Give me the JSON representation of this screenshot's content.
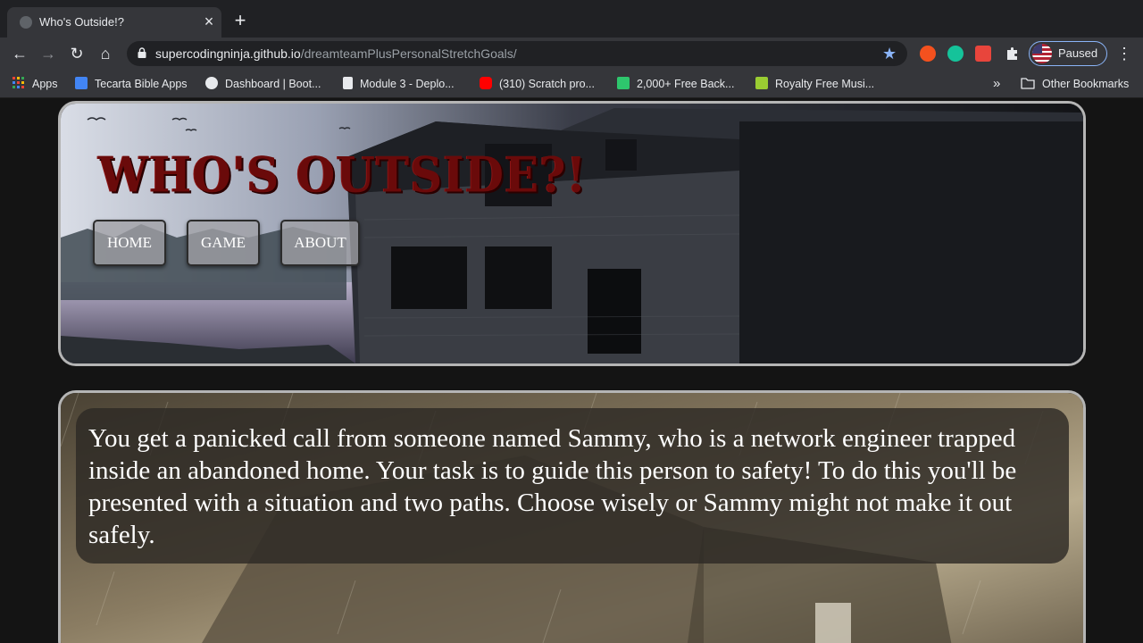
{
  "browser": {
    "tab_title": "Who's Outside!?",
    "tab_close": "×",
    "new_tab": "+",
    "url_host": "supercodingninja.github.io",
    "url_path": "/dreamteamPlusPersonalStretchGoals/",
    "profile_label": "Paused",
    "nav": {
      "back": "←",
      "forward": "→",
      "reload": "↻",
      "home": "⌂",
      "star": "★",
      "menu": "⋮"
    }
  },
  "bookmarks": {
    "items": [
      {
        "label": "Apps",
        "icon": "apps-grid-icon",
        "color": "#ea4335"
      },
      {
        "label": "Tecarta Bible Apps",
        "icon": "tecarta-icon",
        "color": "#4285f4"
      },
      {
        "label": "Dashboard | Boot...",
        "icon": "globe-icon",
        "color": "#e8eaed"
      },
      {
        "label": "Module 3 - Deplo...",
        "icon": "notebook-icon",
        "color": "#e8eaed"
      },
      {
        "label": "(310) Scratch pro...",
        "icon": "youtube-icon",
        "color": "#ff0000"
      },
      {
        "label": "2,000+ Free Back...",
        "icon": "pixabay-icon",
        "color": "#2ec66d"
      },
      {
        "label": "Royalty Free Musi...",
        "icon": "bensound-icon",
        "color": "#9acd32"
      }
    ],
    "overflow": "»",
    "other": "Other Bookmarks"
  },
  "site": {
    "title": "WHO'S OUTSIDE?!",
    "nav": [
      "HOME",
      "GAME",
      "ABOUT"
    ],
    "story": "You get a panicked call from someone named Sammy, who is a network engineer trapped inside an abandoned home. Your task is to guide this person to safety! To do this you'll be presented with a situation and two paths. Choose wisely or Sammy might not make it out safely."
  },
  "colors": {
    "title_red": "#6a0a0a",
    "browser_accent": "#8ab4f8",
    "panel_border": "#b5b5b5"
  }
}
